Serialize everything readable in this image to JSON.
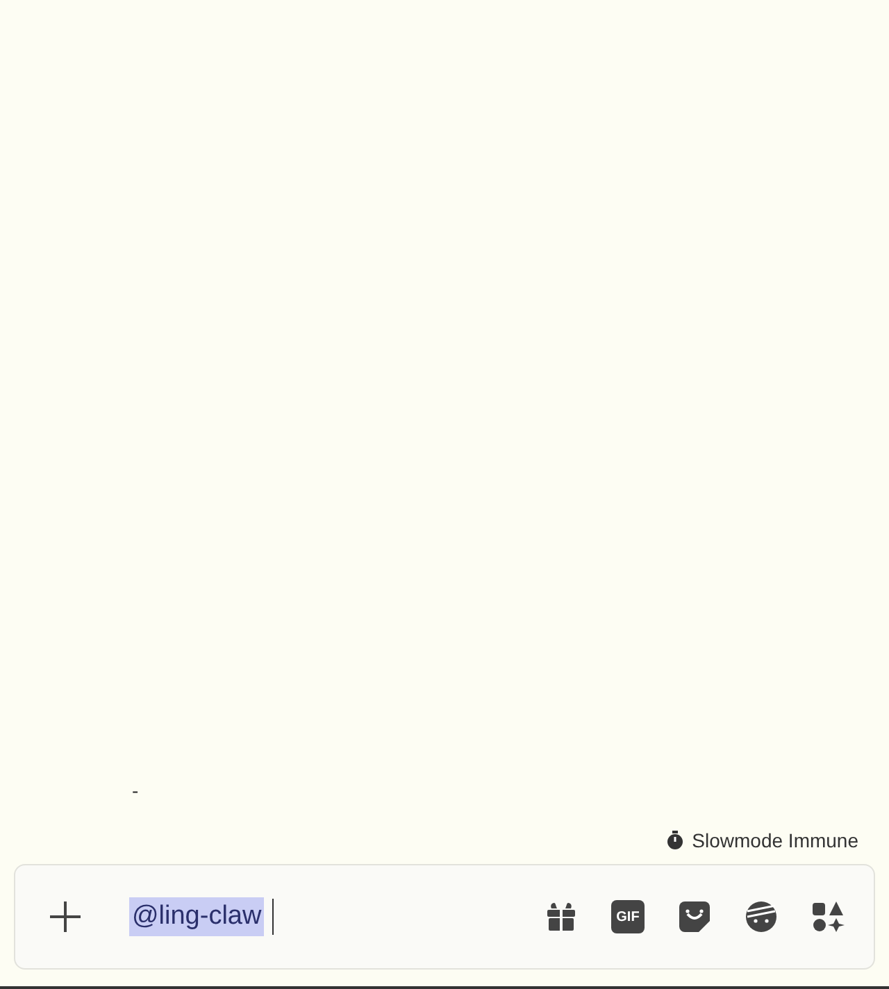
{
  "stray_mark": "-",
  "slowmode": {
    "label": "Slowmode Immune"
  },
  "composer": {
    "value": "@ling-claw",
    "value_selected": true,
    "buttons": [
      {
        "kind": "gift"
      },
      {
        "kind": "gif",
        "label": "GIF"
      },
      {
        "kind": "sticker"
      },
      {
        "kind": "emoji"
      },
      {
        "kind": "apps"
      }
    ]
  }
}
